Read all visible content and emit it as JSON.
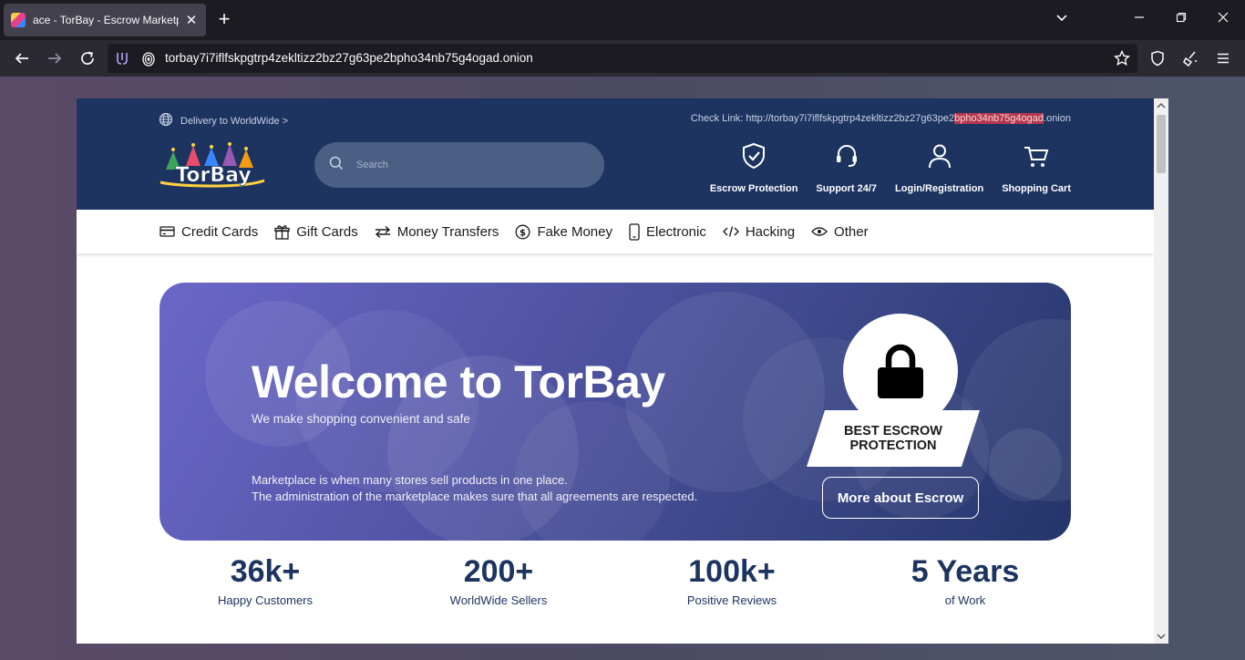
{
  "browser": {
    "tab_title": "ace - TorBay - Escrow Marketpl",
    "url": "torbay7i7iflfskpgtrp4zekltizz2bz27g63pe2bpho34nb75g4ogad.onion"
  },
  "header": {
    "delivery_label": "Delivery to WorldWide >",
    "checklink_prefix": "Check Link: http://torbay7i7iflfskpgtrp4zekltizz2bz27g63pe2",
    "checklink_highlight": "bpho34nb75g4ogad",
    "checklink_suffix": ".onion",
    "logo_text": "TorBay",
    "search_placeholder": "Search",
    "actions": [
      {
        "label": "Escrow Protection",
        "icon": "shield-check-icon"
      },
      {
        "label": "Support 24/7",
        "icon": "headset-icon"
      },
      {
        "label": "Login/Registration",
        "icon": "user-icon"
      },
      {
        "label": "Shopping Cart",
        "icon": "cart-icon"
      }
    ]
  },
  "categories": [
    {
      "label": "Credit Cards",
      "icon": "credit-card-icon"
    },
    {
      "label": "Gift Cards",
      "icon": "gift-icon"
    },
    {
      "label": "Money Transfers",
      "icon": "transfer-icon"
    },
    {
      "label": "Fake Money",
      "icon": "dollar-icon"
    },
    {
      "label": "Electronic",
      "icon": "phone-icon"
    },
    {
      "label": "Hacking",
      "icon": "code-icon"
    },
    {
      "label": "Other",
      "icon": "eye-icon"
    }
  ],
  "hero": {
    "title": "Welcome to TorBay",
    "subtitle": "We make shopping convenient and safe",
    "desc_line1": "Marketplace is when many stores sell products in one place.",
    "desc_line2": "The administration of the marketplace makes sure that all agreements are respected.",
    "badge_line1": "BEST ESCROW",
    "badge_line2": "PROTECTION",
    "button_label": "More about Escrow"
  },
  "stats": [
    {
      "value": "36k+",
      "label": "Happy Customers"
    },
    {
      "value": "200+",
      "label": "WorldWide Sellers"
    },
    {
      "value": "100k+",
      "label": "Positive Reviews"
    },
    {
      "value": "5 Years",
      "label": "of Work"
    }
  ],
  "colors": {
    "header_bg": "#1d3461",
    "accent": "#1d3461",
    "highlight": "#b5384f"
  }
}
